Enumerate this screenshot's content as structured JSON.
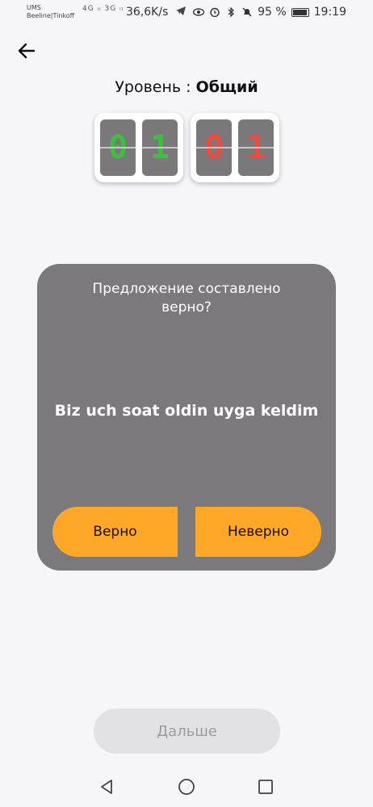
{
  "status_bar": {
    "carrier_line1": "UMS",
    "carrier_line2": "Beeline|Tinkoff",
    "network": "4G ᵢₗ 3G ᵢₗ",
    "speed": "36,6K/s",
    "battery": "95 %",
    "time": "19:19"
  },
  "level": {
    "label": "Уровень : ",
    "value": "Общий"
  },
  "score": {
    "correct": [
      "0",
      "1"
    ],
    "wrong": [
      "0",
      "1"
    ],
    "correct_color": "#3fbf3f",
    "wrong_color": "#f04a3a"
  },
  "card": {
    "question": "Предложение составлено верно?",
    "sentence": "Biz uch soat oldin uyga keldim",
    "true_label": "Верно",
    "false_label": "Неверно",
    "button_color": "#ffa827"
  },
  "next_label": "Дальше",
  "icons": {
    "back": "arrow-left-icon",
    "nav_back": "triangle-back-icon",
    "nav_home": "circle-home-icon",
    "nav_recent": "square-recent-icon"
  }
}
